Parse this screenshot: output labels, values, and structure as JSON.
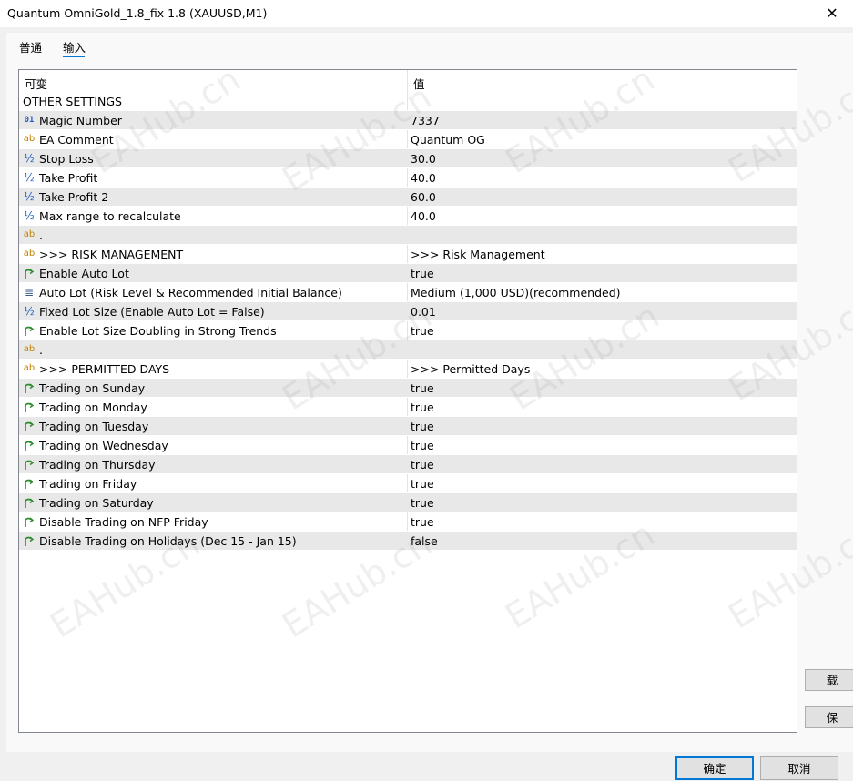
{
  "window": {
    "title": "Quantum OmniGold_1.8_fix 1.8 (XAUUSD,M1)",
    "close_glyph": "✕"
  },
  "tabs": [
    {
      "label": "普通"
    },
    {
      "label": "输入"
    }
  ],
  "grid": {
    "header_variable": "可变",
    "header_value": "值"
  },
  "rows": [
    {
      "icon": "",
      "name": "OTHER SETTINGS",
      "value": "",
      "section": true
    },
    {
      "icon": "number-icon",
      "name": "Magic Number",
      "value": "7337"
    },
    {
      "icon": "string-icon",
      "name": "EA Comment",
      "value": "Quantum OG"
    },
    {
      "icon": "double-icon",
      "name": "Stop Loss",
      "value": "30.0"
    },
    {
      "icon": "double-icon",
      "name": "Take Profit",
      "value": "40.0"
    },
    {
      "icon": "double-icon",
      "name": "Take Profit 2",
      "value": "60.0"
    },
    {
      "icon": "double-icon",
      "name": "Max range to recalculate",
      "value": "40.0"
    },
    {
      "icon": "string-icon",
      "name": ".",
      "value": ""
    },
    {
      "icon": "string-icon",
      "name": ">>> RISK MANAGEMENT",
      "value": ">>> Risk Management"
    },
    {
      "icon": "bool-icon",
      "name": "Enable Auto Lot",
      "value": "true"
    },
    {
      "icon": "enum-icon",
      "name": "Auto Lot (Risk Level & Recommended Initial Balance)",
      "value": "Medium (1,000 USD)(recommended)"
    },
    {
      "icon": "double-icon",
      "name": "Fixed Lot Size (Enable Auto Lot = False)",
      "value": "0.01"
    },
    {
      "icon": "bool-icon",
      "name": "Enable Lot Size Doubling in Strong Trends",
      "value": "true"
    },
    {
      "icon": "string-icon",
      "name": ".",
      "value": ""
    },
    {
      "icon": "string-icon",
      "name": ">>> PERMITTED DAYS",
      "value": ">>> Permitted Days"
    },
    {
      "icon": "bool-icon",
      "name": "Trading on Sunday",
      "value": "true"
    },
    {
      "icon": "bool-icon",
      "name": "Trading on Monday",
      "value": "true"
    },
    {
      "icon": "bool-icon",
      "name": "Trading on Tuesday",
      "value": "true"
    },
    {
      "icon": "bool-icon",
      "name": "Trading on Wednesday",
      "value": "true"
    },
    {
      "icon": "bool-icon",
      "name": "Trading on Thursday",
      "value": "true"
    },
    {
      "icon": "bool-icon",
      "name": "Trading on Friday",
      "value": "true"
    },
    {
      "icon": "bool-icon",
      "name": "Trading on Saturday",
      "value": "true"
    },
    {
      "icon": "bool-icon",
      "name": "Disable Trading on NFP Friday",
      "value": "true"
    },
    {
      "icon": "bool-icon",
      "name": "Disable Trading on Holidays (Dec 15 - Jan 15)",
      "value": "false"
    }
  ],
  "icon_glyphs": {
    "number-icon": "01",
    "string-icon": "ab",
    "double-icon": "½",
    "enum-icon": "≣"
  },
  "side_buttons": {
    "load": "载",
    "save": "保"
  },
  "buttons": {
    "ok": "确定",
    "cancel": "取消"
  },
  "watermark": "EAHub.cn",
  "colors": {
    "accent": "#0078d7",
    "shaded_row": "#e8e8e8"
  }
}
